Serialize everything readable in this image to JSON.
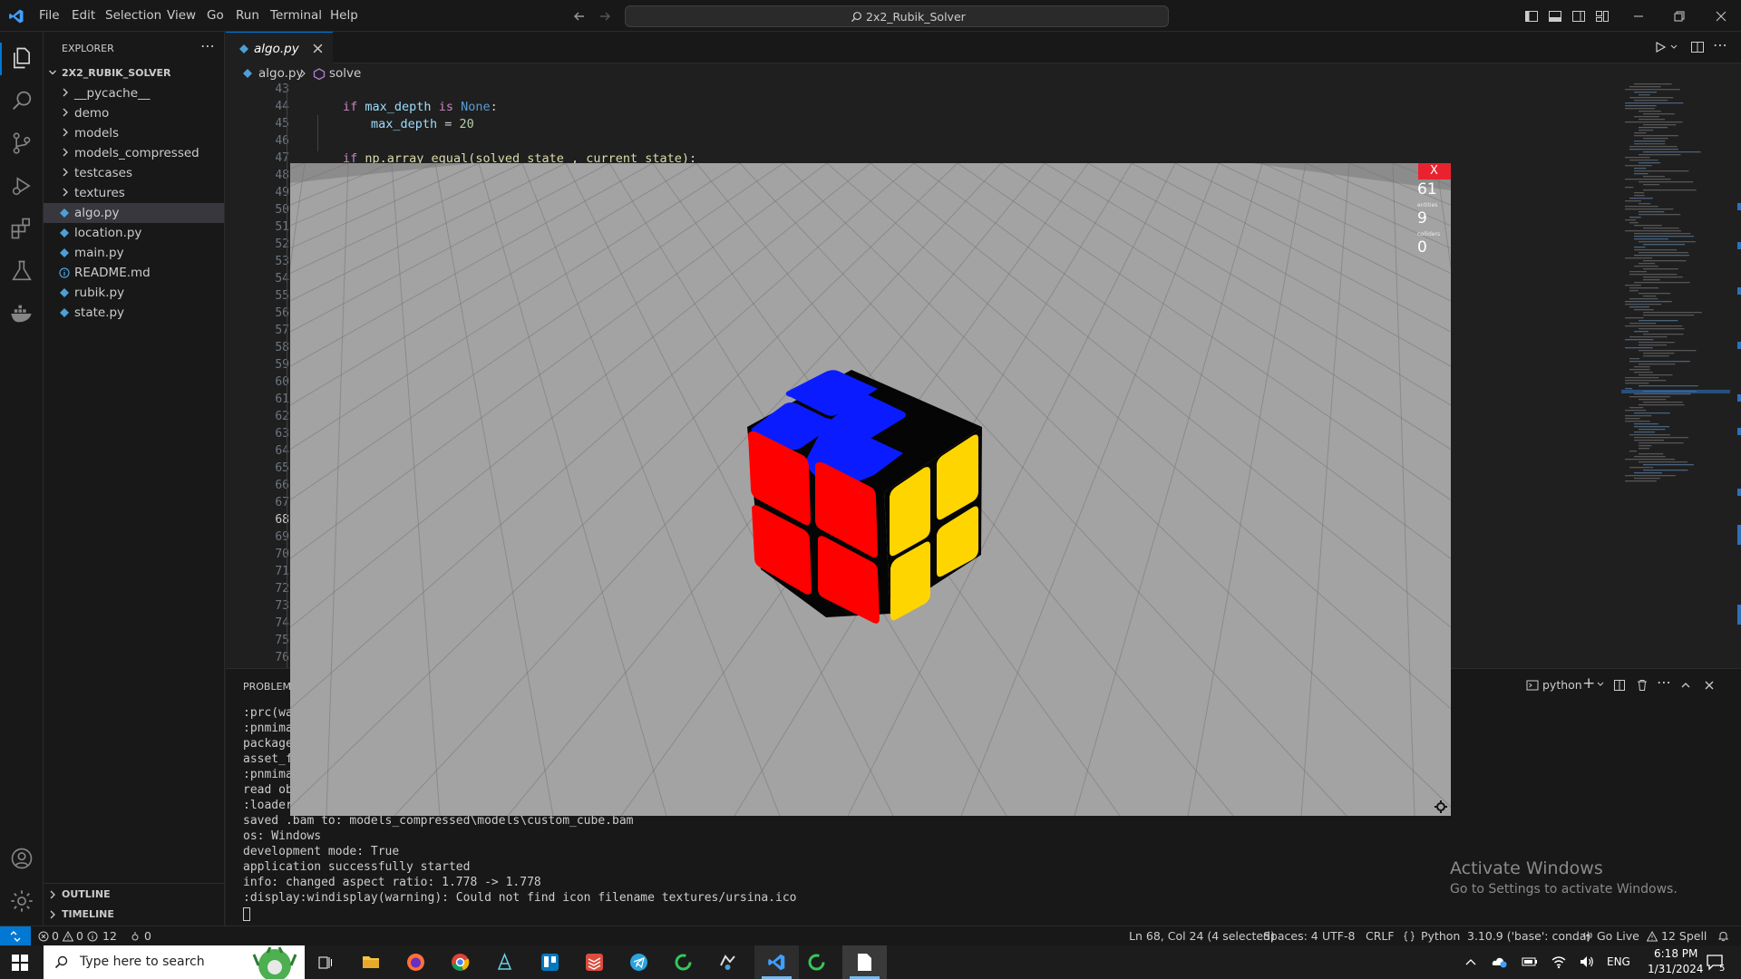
{
  "titlebar": {
    "menu": [
      "File",
      "Edit",
      "Selection",
      "View",
      "Go",
      "Run",
      "Terminal",
      "Help"
    ],
    "search": "2x2_Rubik_Solver"
  },
  "sidebar": {
    "title": "EXPLORER",
    "project": "2X2_RUBIK_SOLVER",
    "folders": [
      "__pycache__",
      "demo",
      "models",
      "models_compressed",
      "testcases",
      "textures"
    ],
    "files": [
      "algo.py",
      "location.py",
      "main.py",
      "README.md",
      "rubik.py",
      "state.py"
    ],
    "outline": "OUTLINE",
    "timeline": "TIMELINE"
  },
  "editor": {
    "tab": "algo.py",
    "breadcrumb_file": "algo.py",
    "breadcrumb_symbol": "solve",
    "line_numbers": [
      "43",
      "44",
      "45",
      "46",
      "47",
      "48",
      "49",
      "50",
      "51",
      "52",
      "53",
      "54",
      "55",
      "56",
      "57",
      "58",
      "59",
      "60",
      "61",
      "62",
      "63",
      "64",
      "65",
      "66",
      "67",
      "68",
      "69",
      "70",
      "71",
      "72",
      "73",
      "74",
      "75",
      "76"
    ],
    "code": {
      "l44_kw1": "if",
      "l44_var": "max_depth",
      "l44_kw2": "is",
      "l44_none": "None",
      "l44_end": ":",
      "l45_var": "max_depth",
      "l45_eq": " = ",
      "l45_num": "20",
      "l47_kw": "if",
      "l47_rest": "np.array_equal(solved_state , current_state):"
    }
  },
  "panel": {
    "problems_tab": "PROBLEMS",
    "shell": "python",
    "left_lines": [
      ":prc(war",
      ":pnmimag",
      "package",
      "asset_fo",
      ":pnmimag",
      "read ob",
      ":loader"
    ],
    "lines": [
      "saved .bam to: models_compressed\\models\\custom_cube.bam",
      "os: Windows",
      "development mode: True",
      "application successfully started",
      "info: changed aspect ratio: 1.778 -> 1.778",
      ":display:windisplay(warning): Could not find icon filename textures/ursina.ico"
    ]
  },
  "watermark": {
    "title": "Activate Windows",
    "subtitle": "Go to Settings to activate Windows."
  },
  "statusbar": {
    "errors": "0",
    "warnings": "0",
    "info": "12",
    "ports": "0",
    "cursor": "Ln 68, Col 24 (4 selected)",
    "spaces": "Spaces: 4",
    "encoding": "UTF-8",
    "eol": "CRLF",
    "language": "Python",
    "interpreter": "3.10.9 ('base': conda)",
    "golive": "Go Live",
    "spell": "12 Spell"
  },
  "game": {
    "close_label": "X",
    "fps": "61",
    "entities_label": "entities",
    "entities": "9",
    "collidedrs_label": "colliders",
    "colliders": "0"
  },
  "taskbar": {
    "search_placeholder": "Type here to search",
    "lang": "ENG",
    "time": "6:18 PM",
    "date": "1/31/2024",
    "notifications": "5"
  },
  "colors": {
    "accent": "#0078d4",
    "cube_blue": "#0a1cff",
    "cube_red": "#ff0000",
    "cube_yellow": "#ffd500",
    "floor": "#a3a3a3"
  }
}
